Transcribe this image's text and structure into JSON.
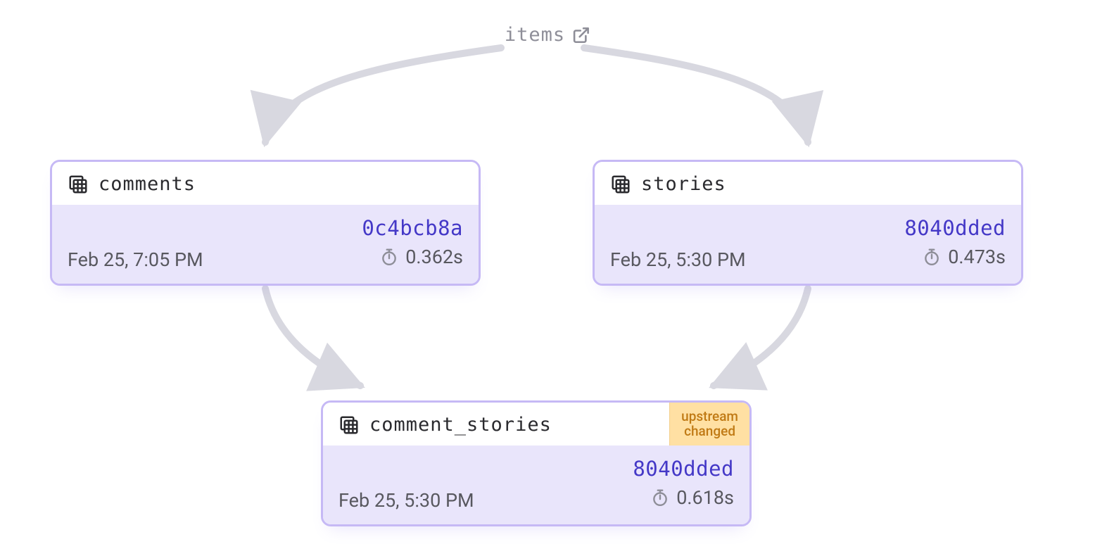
{
  "root": {
    "label": "items"
  },
  "nodes": {
    "comments": {
      "title": "comments",
      "hash": "0c4bcb8a",
      "timestamp": "Feb 25, 7:05 PM",
      "duration": "0.362s"
    },
    "stories": {
      "title": "stories",
      "hash": "8040dded",
      "timestamp": "Feb 25, 5:30 PM",
      "duration": "0.473s"
    },
    "comment_stories": {
      "title": "comment_stories",
      "hash": "8040dded",
      "timestamp": "Feb 25, 5:30 PM",
      "duration": "0.618s",
      "badge_line1": "upstream",
      "badge_line2": "changed"
    }
  }
}
